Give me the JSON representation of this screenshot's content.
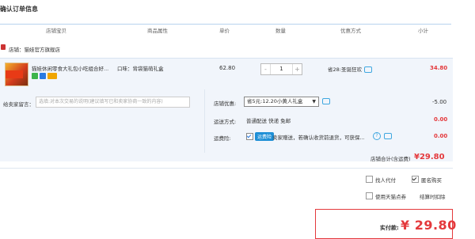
{
  "page": {
    "title": "确认订单信息"
  },
  "columns": [
    "店铺宝贝",
    "商品属性",
    "单价",
    "数量",
    "优惠方式",
    "小计"
  ],
  "shop": {
    "label": "店铺：",
    "name": "猫娃官方旗舰店"
  },
  "item": {
    "name": "猫娃休闲零食大礼包小吃组合好...",
    "attribute": "口味：背袋猫萌礼盒",
    "price": "62.80",
    "quantity": "1",
    "minus": "-",
    "plus": "+",
    "promotion": "省28:圣诞狂欢",
    "subtotal": "34.80"
  },
  "memo": {
    "label": "给卖家留言：",
    "placeholder": "选填:对本次交易的说明(建议填写已和卖家协商一致的内容)"
  },
  "shop_discount": {
    "label": "店铺优惠:",
    "selected": "省5元:12.20小黄人礼盒",
    "amount": "-5.00"
  },
  "shipping": {
    "label": "运送方式:",
    "value": "普通配送 快递 免邮",
    "amount": "0.00"
  },
  "insurance": {
    "label": "运费险:",
    "tag": "运费险",
    "text": "卖家赠送，若确认收货前退货，可获保...",
    "amount": "0.00",
    "help": "?"
  },
  "shop_total": {
    "label": "店铺合计(含运费)",
    "amount": "¥29.80"
  },
  "options": [
    {
      "label": "找人代付",
      "checked": false
    },
    {
      "label": "匿名购买",
      "checked": true
    },
    {
      "label": "使用天猫点券",
      "checked": false
    },
    {
      "label": "结算时扣除",
      "checked": false
    }
  ],
  "payment": {
    "label": "实付款:",
    "amount": "¥ 29.80"
  },
  "colors": {
    "accent_red": "#e4393c",
    "rule_blue": "#b7d2ee",
    "panel_bg": "#f1f5fb",
    "link_blue": "#3fa7e0"
  }
}
